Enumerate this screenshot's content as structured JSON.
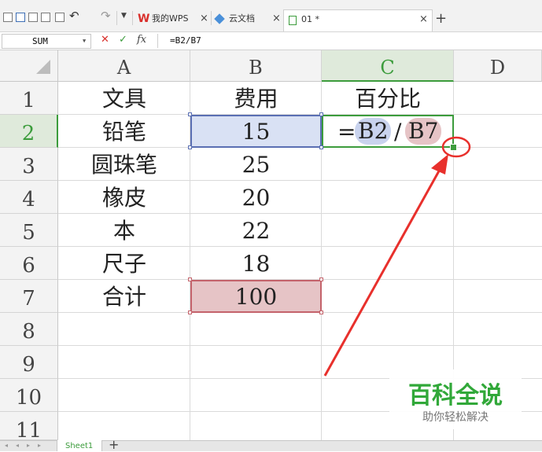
{
  "toolbar": {
    "tabs": [
      {
        "label": "我的WPS",
        "close": "×"
      },
      {
        "label": "云文档",
        "close": "×"
      },
      {
        "label": "01 *",
        "close": "×"
      }
    ],
    "new_tab": "+",
    "dropdown_caret": "▼"
  },
  "formula_bar": {
    "name_box": "SUM",
    "cancel": "✕",
    "confirm": "✓",
    "fx": "fx",
    "formula": "=B2/B7"
  },
  "columns": [
    "A",
    "B",
    "C",
    "D"
  ],
  "rows": [
    "1",
    "2",
    "3",
    "4",
    "5",
    "6",
    "7",
    "8",
    "9",
    "10",
    "11"
  ],
  "cells": {
    "a1": "文具",
    "b1": "费用",
    "c1": "百分比",
    "a2": "铅笔",
    "b2": "15",
    "a3": "圆珠笔",
    "b3": "25",
    "a4": "橡皮",
    "b4": "20",
    "a5": "本",
    "b5": "22",
    "a6": "尺子",
    "b6": "18",
    "a7": "合计",
    "b7": "100"
  },
  "edit_cell": {
    "eq": "=",
    "ref1": "B2",
    "slash": "/",
    "ref2": "B7"
  },
  "watermark": {
    "title": "百科全说",
    "subtitle": "助你轻松解决"
  },
  "sheets": {
    "active": "Sheet1",
    "add": "+"
  },
  "colors": {
    "ref1_fill": "#d9e1f4",
    "ref1_border": "#5a6fb3",
    "ref2_fill": "#e6c4c6",
    "ref2_border": "#c4636b",
    "active_cell_border": "#3c9c3c",
    "annotation": "#e8302c",
    "watermark_green": "#31a839",
    "wps_red": "#d9302c"
  }
}
